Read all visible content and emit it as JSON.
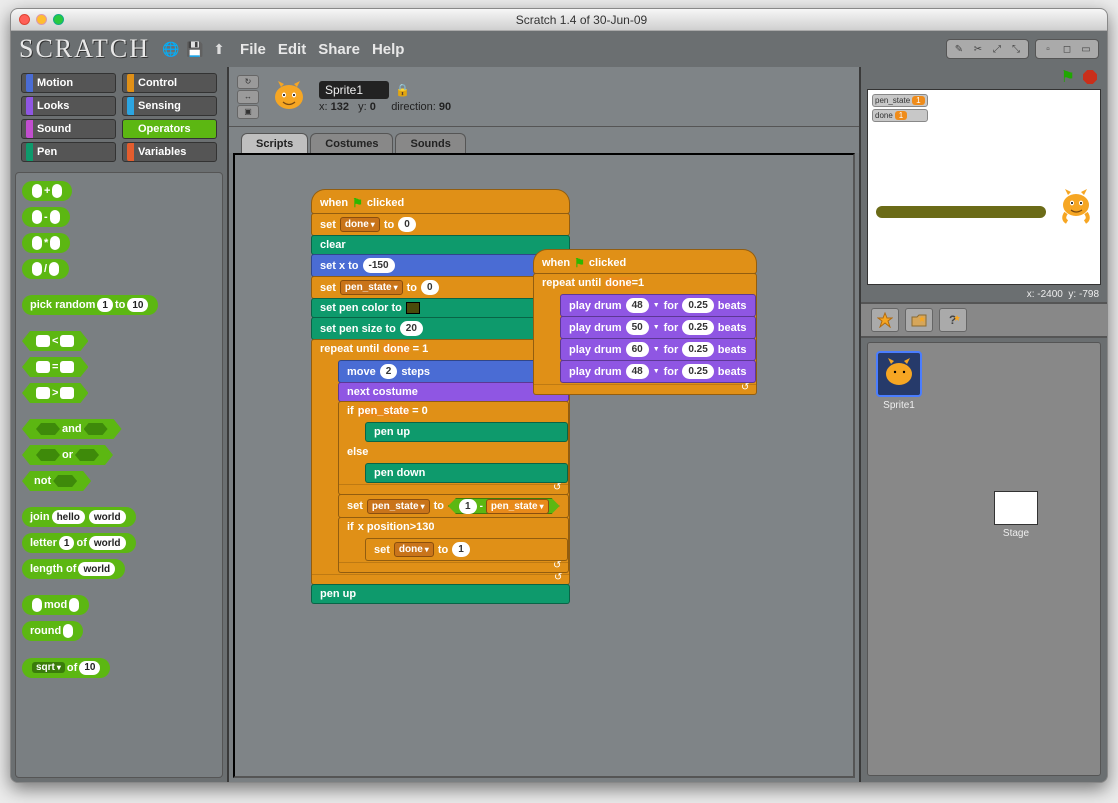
{
  "window": {
    "title": "Scratch 1.4 of 30-Jun-09"
  },
  "logo": "SCRATCH",
  "menu": [
    "File",
    "Edit",
    "Share",
    "Help"
  ],
  "categories": [
    {
      "name": "Motion",
      "color": "#4a6cd4"
    },
    {
      "name": "Control",
      "color": "#e09017"
    },
    {
      "name": "Looks",
      "color": "#8f56e3"
    },
    {
      "name": "Sensing",
      "color": "#2ca5e2"
    },
    {
      "name": "Sound",
      "color": "#c14ecf"
    },
    {
      "name": "Operators",
      "color": "#5cb712",
      "selected": true
    },
    {
      "name": "Pen",
      "color": "#0e9a6c"
    },
    {
      "name": "Variables",
      "color": "#e35d2e"
    }
  ],
  "palette": {
    "pick_random": "pick random",
    "to": "to",
    "and": "and",
    "or": "or",
    "not": "not",
    "join": "join",
    "hello": "hello",
    "world": "world",
    "letter": "letter",
    "of": "of",
    "length_of": "length of",
    "mod": "mod",
    "round": "round",
    "sqrt": "sqrt",
    "one": "1",
    "ten": "10",
    "plus": "+",
    "minus": "-",
    "times": "*",
    "div": "/",
    "lt": "<",
    "eq": "=",
    "gt": ">"
  },
  "sprite": {
    "name": "Sprite1",
    "x": "132",
    "y": "0",
    "direction": "90",
    "xlabel": "x:",
    "ylabel": "y:",
    "dirlabel": "direction:"
  },
  "tabs": {
    "scripts": "Scripts",
    "costumes": "Costumes",
    "sounds": "Sounds"
  },
  "script1": {
    "when": "when",
    "clicked": "clicked",
    "set": "set",
    "done": "done",
    "to": "to",
    "zero": "0",
    "one": "1",
    "clear": "clear",
    "setx": "set x to",
    "neg150": "-150",
    "pen_state": "pen_state",
    "pencolor": "set pen color to",
    "pensize": "set pen size to",
    "twenty": "20",
    "repeat_until": "repeat until",
    "move": "move",
    "two": "2",
    "steps": "steps",
    "next_costume": "next costume",
    "if": "if",
    "penup": "pen up",
    "else": "else",
    "pendown": "pen down",
    "xpos": "x position",
    "gt": ">",
    "v130": "130",
    "minus": "-"
  },
  "script2": {
    "when": "when",
    "clicked": "clicked",
    "repeat_until": "repeat until",
    "done": "done",
    "eq": "=",
    "one": "1",
    "play_drum": "play drum",
    "for": "for",
    "beats": "beats",
    "d": [
      "48",
      "50",
      "60",
      "48"
    ],
    "t": "0.25"
  },
  "stage_vars": {
    "pen_state": "pen_state",
    "pen_state_val": "1",
    "done": "done",
    "done_val": "1"
  },
  "readout": {
    "xlabel": "x:",
    "x": "-2400",
    "ylabel": "y:",
    "y": "-798"
  },
  "sprite_list": {
    "sprite1": "Sprite1",
    "stage": "Stage"
  }
}
